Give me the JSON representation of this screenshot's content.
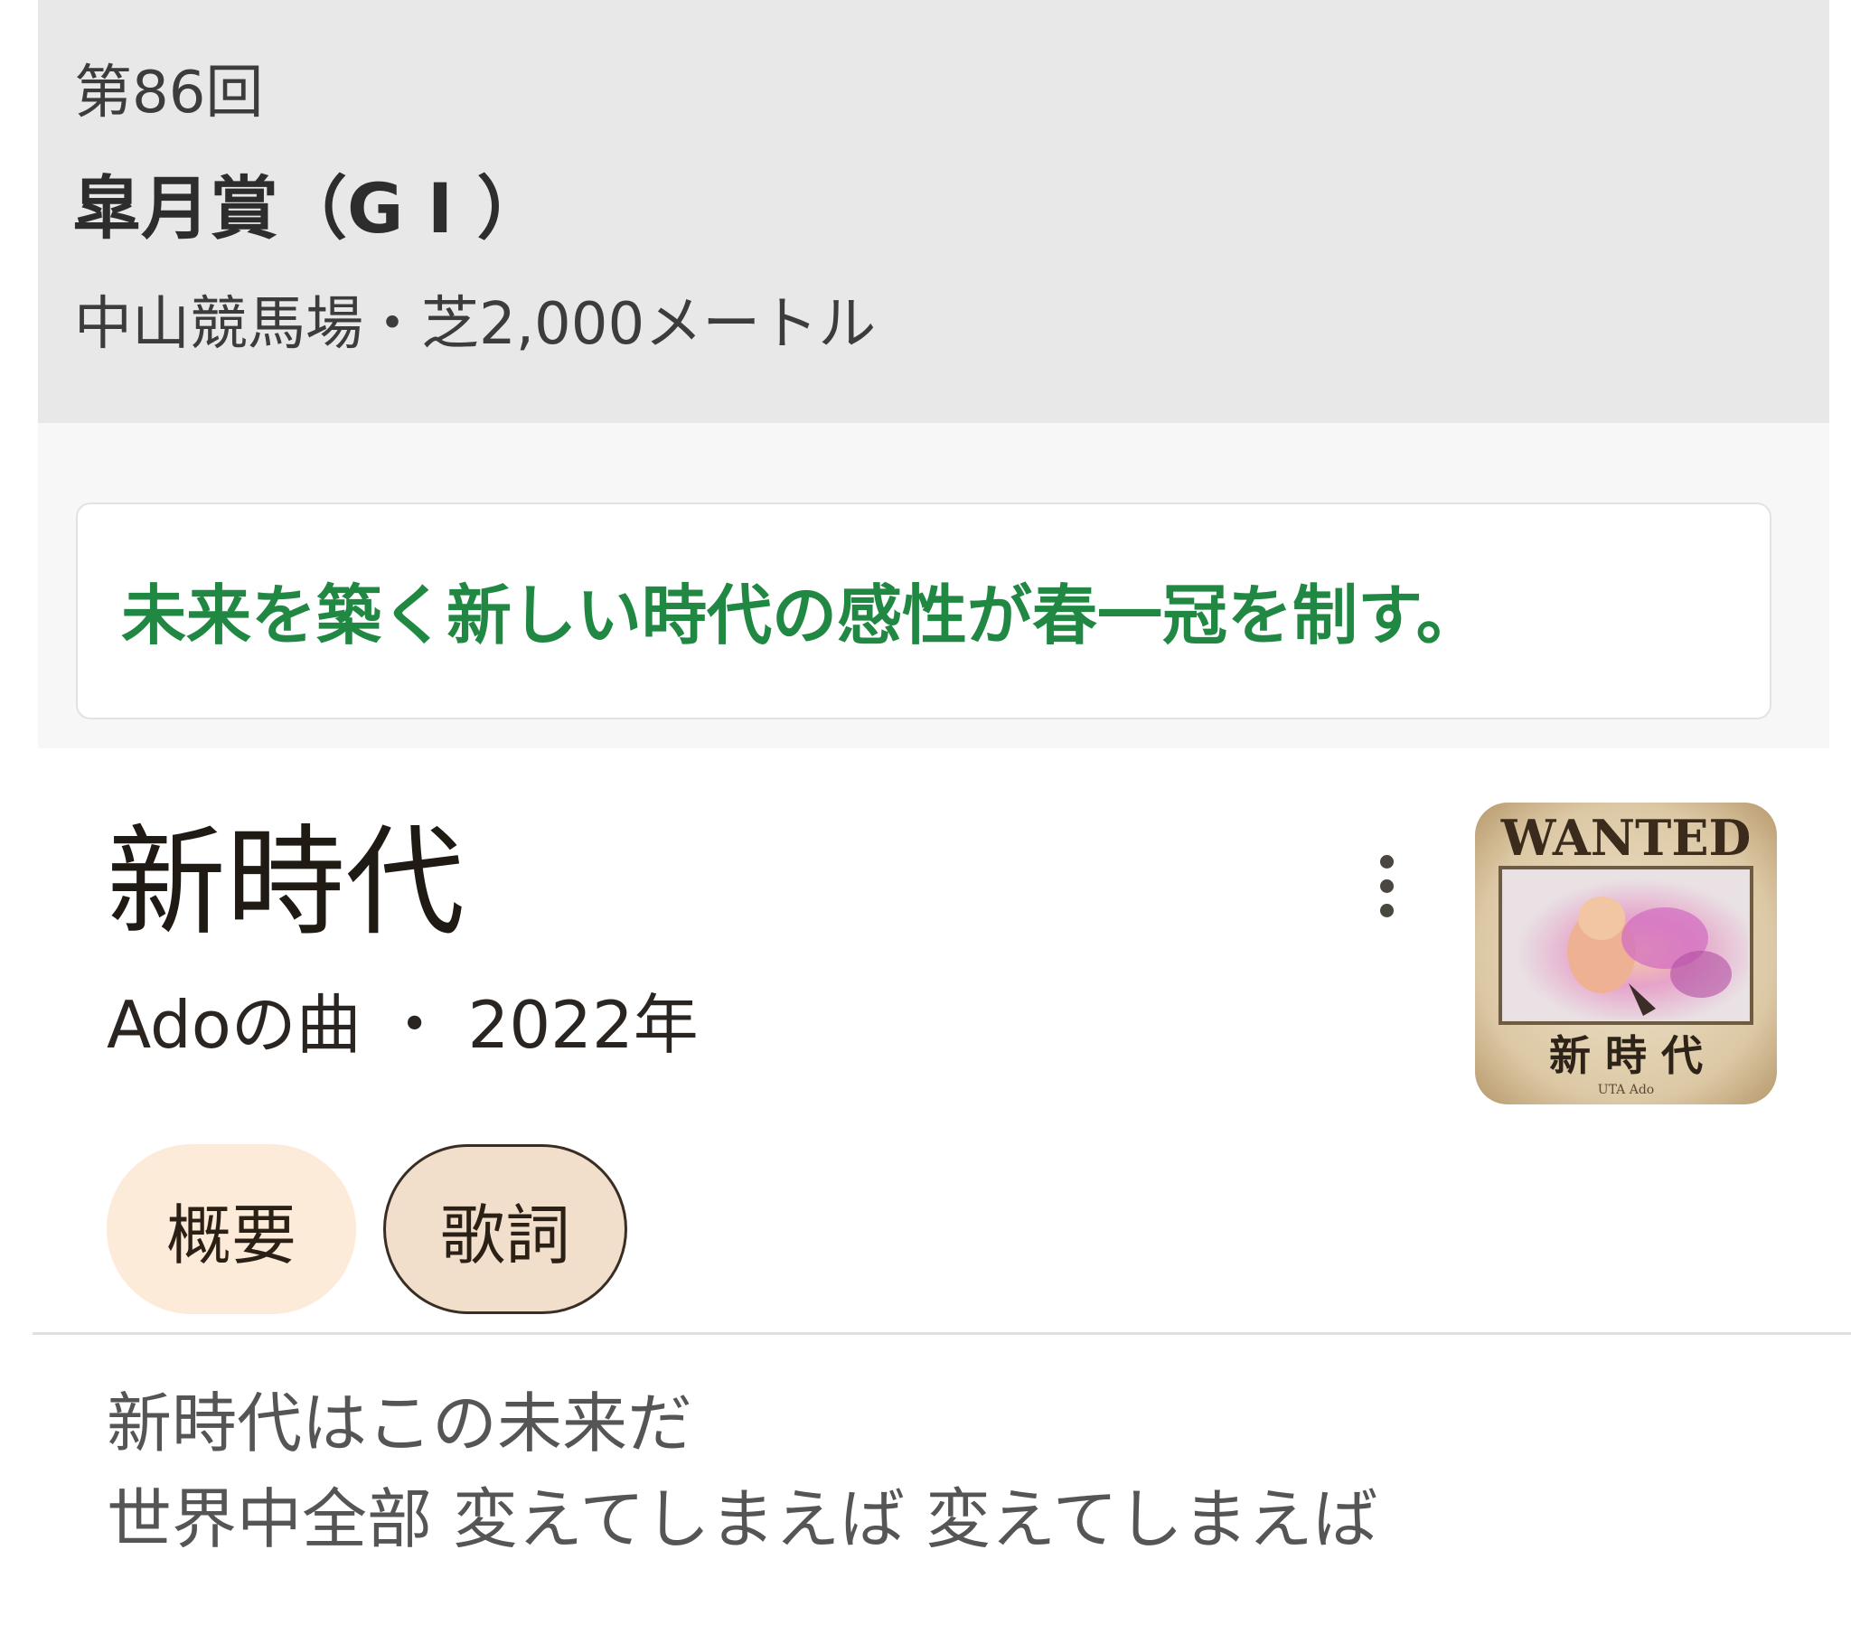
{
  "race": {
    "number": "第86回",
    "name": "皐月賞（G I ）",
    "venue": "中山競馬場・芝2,000メートル",
    "slogan": "未来を築く新しい時代の感性が春一冠を制す。"
  },
  "song": {
    "title": "新時代",
    "meta": "Adoの曲 ・ 2022年",
    "more_icon": "more-vert-icon",
    "cover": {
      "header_text": "WANTED",
      "title_text": "新 時 代",
      "credit_text": "UTA Ado"
    },
    "tabs": [
      {
        "label": "概要",
        "selected": false
      },
      {
        "label": "歌詞",
        "selected": true
      }
    ],
    "lyrics": [
      "新時代はこの未来だ",
      "世界中全部 変えてしまえば 変えてしまえば"
    ]
  },
  "colors": {
    "header_bg": "#e8e8e8",
    "slogan_green": "#218844",
    "tab_overview_bg": "#fdebd9",
    "tab_lyrics_bg": "#f1dfcc"
  }
}
